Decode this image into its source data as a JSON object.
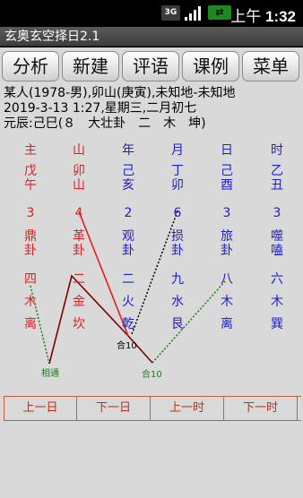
{
  "status_bar": {
    "network": "3G",
    "usb": "USB",
    "time_prefix": "上午",
    "time": "1:32"
  },
  "app_title": "玄奥玄空择日2.1",
  "toolbar": [
    "分析",
    "新建",
    "评语",
    "课例",
    "菜单"
  ],
  "info_lines": [
    "某人(1978-男),卯山(庚寅),未知地-未知地",
    "2019-3-13 1:27,星期三,二月初七",
    "元辰:己巳(８　大壮卦　二　木　坤)"
  ],
  "columns": [
    {
      "header": "主",
      "stem": "戊",
      "branch": "午",
      "number": "3",
      "gua1": "鼎",
      "gua2": "卦",
      "n2": "四",
      "element": "木",
      "trigram": "离",
      "color": "red"
    },
    {
      "header": "山",
      "stem": "卯",
      "branch": "山",
      "number": "4",
      "gua1": "革",
      "gua2": "卦",
      "n2": "二",
      "element": "金",
      "trigram": "坎",
      "color": "red"
    },
    {
      "header": "年",
      "stem": "己",
      "branch": "亥",
      "number": "2",
      "gua1": "观",
      "gua2": "卦",
      "n2": "二",
      "element": "火",
      "trigram": "乾",
      "color": "blue"
    },
    {
      "header": "月",
      "stem": "丁",
      "branch": "卯",
      "number": "6",
      "gua1": "损",
      "gua2": "卦",
      "n2": "九",
      "element": "水",
      "trigram": "艮",
      "color": "blue"
    },
    {
      "header": "日",
      "stem": "己",
      "branch": "酉",
      "number": "3",
      "gua1": "旅",
      "gua2": "卦",
      "n2": "八",
      "element": "木",
      "trigram": "离",
      "color": "blue"
    },
    {
      "header": "时",
      "stem": "乙",
      "branch": "丑",
      "number": "3",
      "gua1": "噬",
      "gua2": "嗑",
      "n2": "六",
      "element": "木",
      "trigram": "巽",
      "color": "blue"
    }
  ],
  "annotations": {
    "xiangtong": "相通",
    "he10_a": "合10",
    "he10_b": "合10"
  },
  "bottom_nav": [
    "上一日",
    "下一日",
    "上一时",
    "下一时"
  ],
  "colors": {
    "red": "#e02020",
    "blue": "#2020c8",
    "green": "#1a7a1a",
    "nav_text": "#c03010"
  }
}
